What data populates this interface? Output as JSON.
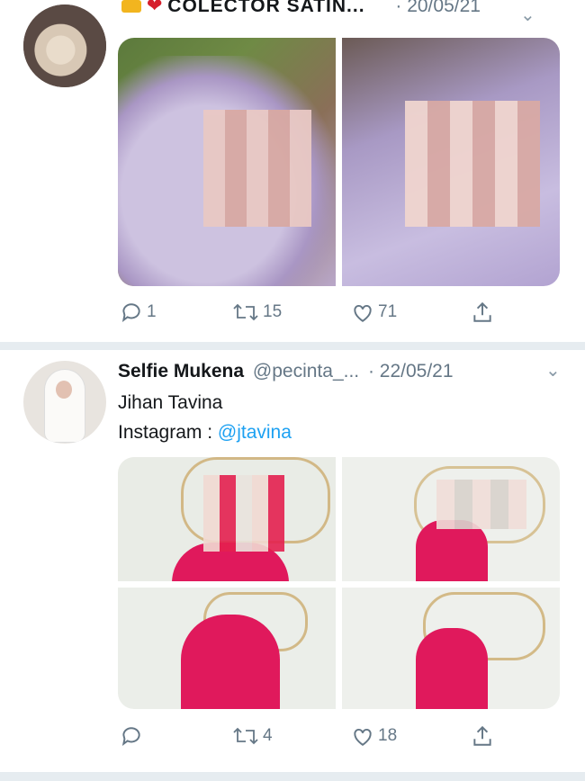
{
  "tweet1": {
    "name": "COLECTOR SATIN...",
    "date": "· 20/05/21",
    "actions": {
      "reply": "1",
      "retweet": "15",
      "like": "71"
    }
  },
  "tweet2": {
    "name": "Selfie Mukena",
    "handle": "@pecinta_...",
    "date": "· 22/05/21",
    "line1": "Jihan Tavina",
    "line2_prefix": "Instagram : ",
    "line2_link": "@jtavina",
    "actions": {
      "reply": "",
      "retweet": "4",
      "like": "18"
    }
  },
  "colors": {
    "accent": "#1da1f2",
    "muted": "#657786",
    "divider": "#e6ecf0",
    "heart": "#e0245e"
  }
}
